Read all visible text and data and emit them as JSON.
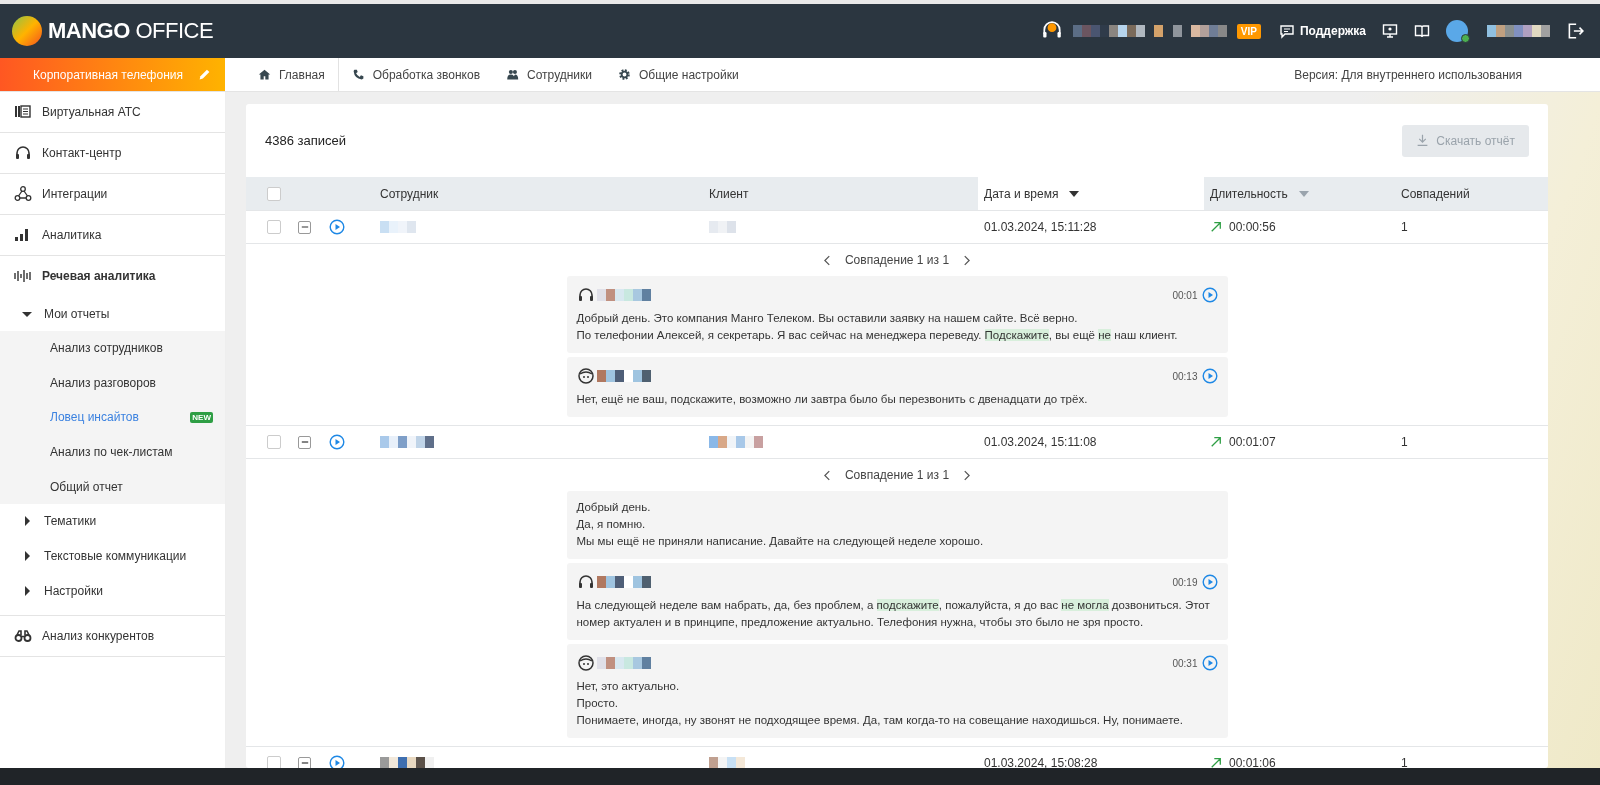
{
  "header": {
    "logo": {
      "bold": "MANGO",
      "light": "OFFICE"
    },
    "vip_badge": "VIP",
    "support": "Поддержка"
  },
  "subheader": {
    "product": "Корпоративная телефония",
    "nav": [
      {
        "label": "Главная",
        "selected": false
      },
      {
        "label": "Обработка звонков",
        "selected": false
      },
      {
        "label": "Сотрудники",
        "selected": false
      },
      {
        "label": "Общие настройки",
        "selected": false
      }
    ],
    "version": "Версия: Для внутреннего использования"
  },
  "sidebar": {
    "items": [
      {
        "label": "Виртуальная АТС",
        "selected": false
      },
      {
        "label": "Контакт-центр",
        "selected": false
      },
      {
        "label": "Интеграции",
        "selected": false
      },
      {
        "label": "Аналитика",
        "selected": false
      },
      {
        "label": "Речевая аналитика",
        "selected": false,
        "expanded": true,
        "children": [
          {
            "label": "Мои отчеты",
            "selected": false,
            "expanded": true,
            "children": [
              {
                "label": "Анализ сотрудников",
                "selected": false
              },
              {
                "label": "Анализ разговоров",
                "selected": false
              },
              {
                "label": "Ловец инсайтов",
                "selected": true,
                "badge": "NEW"
              },
              {
                "label": "Анализ по чек-листам",
                "selected": false
              },
              {
                "label": "Общий отчет",
                "selected": false
              }
            ]
          },
          {
            "label": "Тематики",
            "selected": false,
            "expanded": false
          },
          {
            "label": "Текстовые коммуникации",
            "selected": false,
            "expanded": false
          },
          {
            "label": "Настройки",
            "selected": false,
            "expanded": false
          }
        ]
      },
      {
        "label": "Анализ конкурентов",
        "selected": false
      }
    ]
  },
  "records": {
    "count": "4386 записей",
    "download_button": {
      "label": "Скачать отчёт",
      "disabled": true
    },
    "select_all": {
      "checked": false
    },
    "columns": [
      {
        "label": "Сотрудник",
        "kind": "plain"
      },
      {
        "label": "Клиент",
        "kind": "plain"
      },
      {
        "label": "Дата и время",
        "kind": "sorted"
      },
      {
        "label": "Длительность",
        "kind": "sortable"
      },
      {
        "label": "Совпадений",
        "kind": "plain"
      }
    ],
    "rows": [
      {
        "checked": false,
        "expanded": true,
        "date": "01.03.2024, 15:11:28",
        "kind": "outgoing",
        "duration": "00:00:56",
        "matches": "1",
        "match": {
          "label": "Совпадение 1 из 1",
          "segments": [
            {
              "kind": "operator",
              "time": "00:01",
              "lines": [
                [
                  {
                    "text": "Добрый день. Это компания Манго Телеком. Вы оставили заявку на нашем сайте. Всё верно.",
                    "highlight": false
                  }
                ],
                [
                  {
                    "text": "По телефонии Алексей, я секретарь. Я вас сейчас на менеджера переведу. ",
                    "highlight": false
                  },
                  {
                    "text": "Подскажите",
                    "highlight": true
                  },
                  {
                    "text": ", вы ещё ",
                    "highlight": false
                  },
                  {
                    "text": "не",
                    "highlight": true
                  },
                  {
                    "text": " наш клиент.",
                    "highlight": false
                  }
                ]
              ]
            },
            {
              "kind": "client",
              "time": "00:13",
              "lines": [
                [
                  {
                    "text": "Нет, ещё не ваш, подскажите, возможно ли завтра было бы перезвонить с двенадцати до трёх.",
                    "highlight": false
                  }
                ]
              ]
            }
          ]
        }
      },
      {
        "checked": false,
        "expanded": true,
        "date": "01.03.2024, 15:11:08",
        "kind": "outgoing",
        "duration": "00:01:07",
        "matches": "1",
        "match": {
          "label": "Совпадение 1 из 1",
          "segments": [
            {
              "kind": "text",
              "lines": [
                [
                  {
                    "text": "Добрый день.",
                    "highlight": false
                  }
                ],
                [
                  {
                    "text": "Да, я помню.",
                    "highlight": false
                  }
                ],
                [
                  {
                    "text": "Мы мы ещё не приняли написание. Давайте на следующей неделе хорошо.",
                    "highlight": false
                  }
                ]
              ]
            },
            {
              "kind": "operator",
              "time": "00:19",
              "lines": [
                [
                  {
                    "text": "На следующей неделе вам набрать, да, без проблем, а ",
                    "highlight": false
                  },
                  {
                    "text": "подскажите",
                    "highlight": true
                  },
                  {
                    "text": ", пожалуйста, я до вас ",
                    "highlight": false
                  },
                  {
                    "text": "не ",
                    "highlight": true
                  },
                  {
                    "text": "могла",
                    "highlight": true
                  },
                  {
                    "text": " дозвониться. Этот номер актуален и в принципе, предложение актуально. Телефония нужна, чтобы это было не зря просто.",
                    "highlight": false
                  }
                ]
              ]
            },
            {
              "kind": "client",
              "time": "00:31",
              "lines": [
                [
                  {
                    "text": "Нет, это актуально.",
                    "highlight": false
                  }
                ],
                [
                  {
                    "text": "Просто.",
                    "highlight": false
                  }
                ],
                [
                  {
                    "text": "Понимаете, иногда, ну звонят не подходящее время. Да, там когда-то на совещание находишься. Ну, понимаете.",
                    "highlight": false
                  }
                ]
              ]
            }
          ]
        }
      },
      {
        "checked": false,
        "expanded": true,
        "date": "01.03.2024, 15:08:28",
        "kind": "outgoing",
        "duration": "00:01:06",
        "matches": "1"
      }
    ]
  }
}
